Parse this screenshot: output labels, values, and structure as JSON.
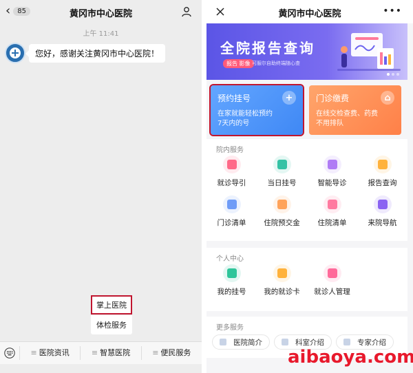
{
  "chat": {
    "back_badge": "85",
    "title": "黄冈市中心医院",
    "timestamp": "上午 11:41",
    "message": "您好，感谢关注黄冈市中心医院！",
    "popup": [
      "掌上医院",
      "体检服务"
    ],
    "menu": [
      "医院资讯",
      "智慧医院",
      "便民服务"
    ]
  },
  "app": {
    "title": "黄冈市中心医院",
    "banner": {
      "title": "全院报告查询",
      "tag": "报告 影像",
      "subtitle": "可服尔自助终端随心查"
    },
    "cards": [
      {
        "title": "预约挂号",
        "desc1": "在家就能轻松预约",
        "desc2": "7天内的号",
        "icon": "plus-icon"
      },
      {
        "title": "门诊缴费",
        "desc1": "在线交检查费、药费",
        "desc2": "不用排队",
        "icon": "home-icon"
      }
    ],
    "hospital_services": {
      "title": "院内服务",
      "items": [
        {
          "label": "就诊导引",
          "color": "#ff6a88"
        },
        {
          "label": "当日挂号",
          "color": "#35c2a5"
        },
        {
          "label": "智能导诊",
          "color": "#b07cf5"
        },
        {
          "label": "报告查询",
          "color": "#ffb23c"
        },
        {
          "label": "门诊清单",
          "color": "#6f9cf7"
        },
        {
          "label": "住院预交金",
          "color": "#ffa35a"
        },
        {
          "label": "住院清单",
          "color": "#ff7aa0"
        },
        {
          "label": "来院导航",
          "color": "#8a63f2"
        }
      ]
    },
    "personal_center": {
      "title": "个人中心",
      "items": [
        {
          "label": "我的挂号",
          "color": "#2fc59a"
        },
        {
          "label": "我的就诊卡",
          "color": "#ffb23c"
        },
        {
          "label": "就诊人管理",
          "color": "#ff6a9a"
        }
      ]
    },
    "more_services": {
      "title": "更多服务",
      "items": [
        "医院简介",
        "科室介绍",
        "专家介绍"
      ]
    }
  },
  "watermark": "aibaoya.com"
}
